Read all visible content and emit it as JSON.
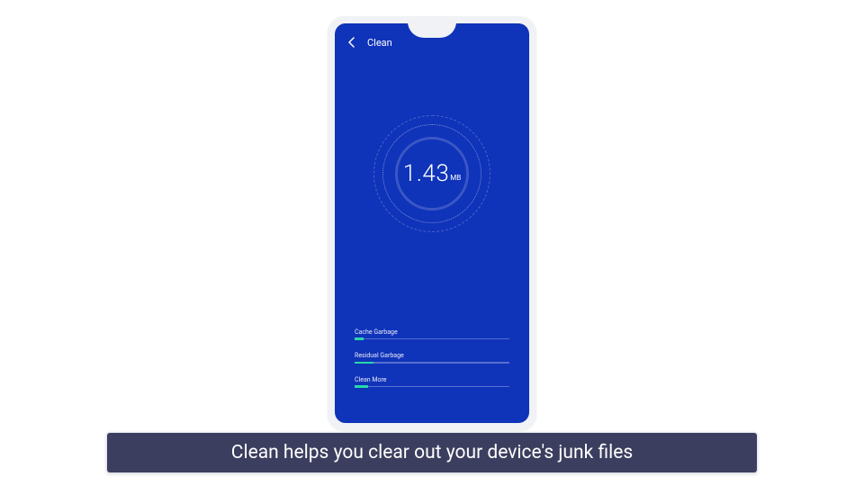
{
  "header": {
    "title": "Clean"
  },
  "gauge": {
    "value": "1.43",
    "unit": "MB"
  },
  "categories": [
    {
      "label": "Cache Garbage",
      "fill_pct": 6
    },
    {
      "label": "Residual Garbage",
      "fill_pct": 12
    },
    {
      "label": "Clean More",
      "fill_pct": 9
    }
  ],
  "caption": "Clean helps you clear out your device's junk files",
  "colors": {
    "screen_bg": "#0f33b9",
    "accent": "#26d9a8",
    "caption_bg": "#3b3e5e"
  }
}
